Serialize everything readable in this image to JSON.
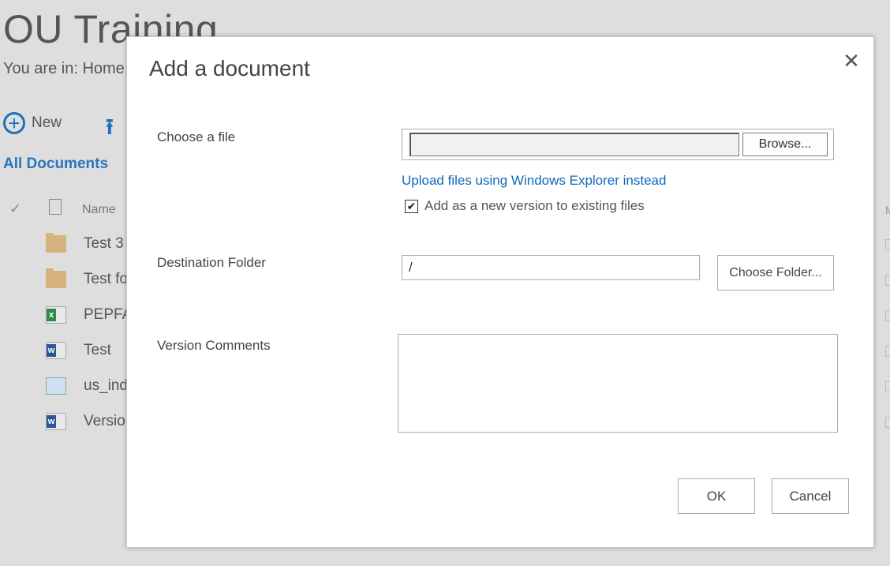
{
  "background": {
    "site_title": "OU Training",
    "breadcrumb": "You are in: Home",
    "new_label": "New",
    "view_label": "All Documents",
    "column_name": "Name",
    "right_column_head": "M",
    "items": [
      {
        "label": "Test 3",
        "icon": "folder-icon"
      },
      {
        "label": "Test fo",
        "icon": "folder-icon"
      },
      {
        "label": "PEPFA",
        "icon": "excel-icon"
      },
      {
        "label": "Test",
        "icon": "word-icon"
      },
      {
        "label": "us_ind",
        "icon": "image-icon"
      },
      {
        "label": "Versio",
        "icon": "word-icon"
      }
    ]
  },
  "dialog": {
    "title": "Add a document",
    "close_symbol": "✕",
    "choose_file_label": "Choose a file",
    "file_value": "",
    "browse_label": "Browse...",
    "explorer_link": "Upload files using Windows Explorer instead",
    "add_version_label": "Add as a new version to existing files",
    "add_version_checked": true,
    "destination_label": "Destination Folder",
    "destination_value": "/",
    "choose_folder_label": "Choose Folder...",
    "version_comments_label": "Version Comments",
    "version_comments_value": "",
    "ok_label": "OK",
    "cancel_label": "Cancel"
  },
  "colors": {
    "accent": "#1f70b9",
    "link": "#0f68b8",
    "overlay_bg": "#dedede"
  }
}
